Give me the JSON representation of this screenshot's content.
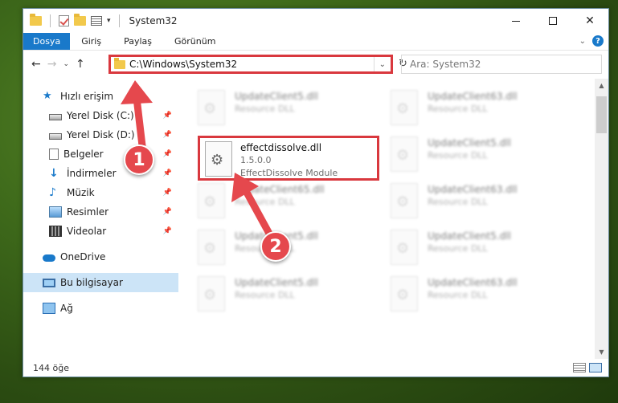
{
  "window": {
    "title": "System32"
  },
  "ribbon": {
    "tabs": [
      "Dosya",
      "Giriş",
      "Paylaş",
      "Görünüm"
    ],
    "help": "?"
  },
  "address": {
    "path": "C:\\Windows\\System32",
    "search_placeholder": "Ara: System32"
  },
  "nav": {
    "back": "←",
    "forward": "→",
    "recent": "⌄",
    "up": "↑",
    "refresh": "↻",
    "dropdown": "⌄"
  },
  "sidebar": {
    "quick_access": "Hızlı erişim",
    "items": [
      "Yerel Disk (C:)",
      "Yerel Disk (D:)",
      "Belgeler",
      "İndirmeler",
      "Müzik",
      "Resimler",
      "Videolar"
    ],
    "onedrive": "OneDrive",
    "this_pc": "Bu bilgisayar",
    "network": "Ağ"
  },
  "files": {
    "blurred": [
      {
        "name": "UpdateClient5.dll",
        "desc": "Resource DLL"
      },
      {
        "name": "UpdateClient63.dll",
        "desc": "Resource DLL"
      },
      {
        "name": "",
        "desc": ""
      },
      {
        "name": "UpdateClient5.dll",
        "desc": "Resource DLL"
      },
      {
        "name": "UpdateClient65.dll",
        "desc": "Resource DLL"
      },
      {
        "name": "UpdateClient63.dll",
        "desc": "Resource DLL"
      },
      {
        "name": "UpdateClient5.dll",
        "desc": "Resource DLL"
      },
      {
        "name": "UpdateClient5.dll",
        "desc": "Resource DLL"
      },
      {
        "name": "UpdateClient5.dll",
        "desc": "Resource DLL"
      },
      {
        "name": "UpdateClient63.dll",
        "desc": "Resource DLL"
      }
    ],
    "highlighted": {
      "name": "effectdissolve.dll",
      "version": "1.5.0.0",
      "desc": "EffectDissolve Module"
    }
  },
  "status": {
    "count": "144 öğe"
  },
  "markers": {
    "one": "1",
    "two": "2"
  },
  "colors": {
    "accent": "#1979ca",
    "annotation": "#e5484d"
  }
}
